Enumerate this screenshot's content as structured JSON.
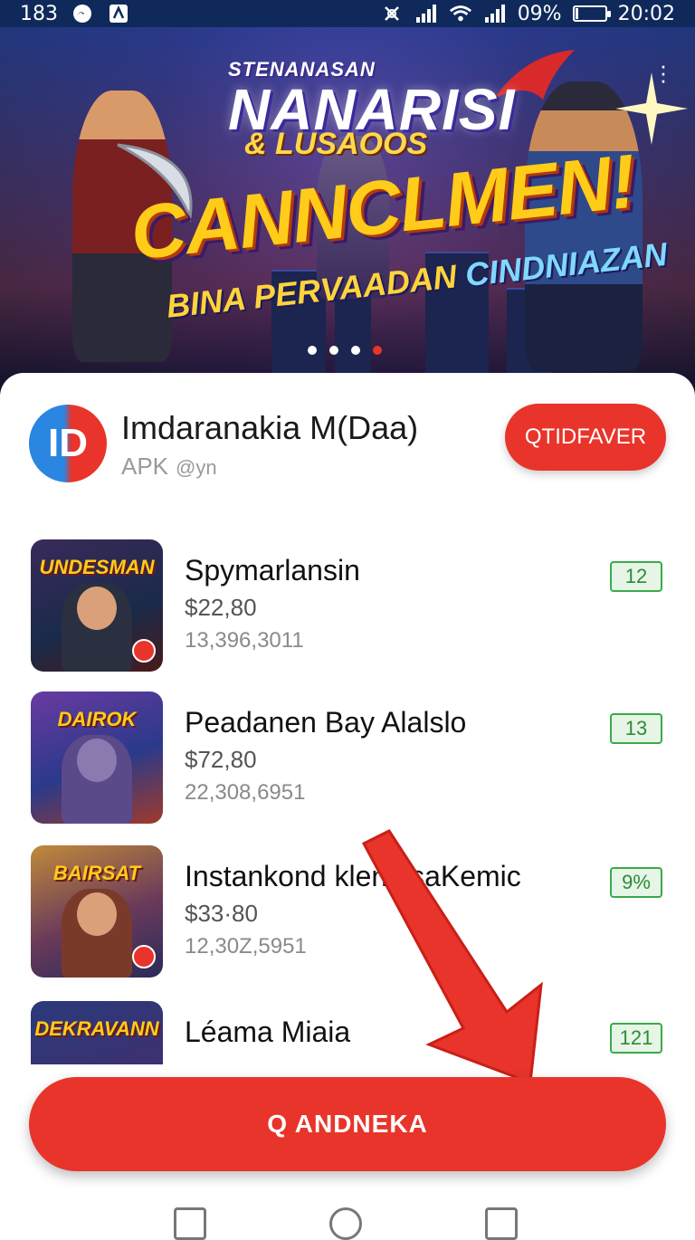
{
  "status_bar": {
    "left_text": "183",
    "battery_percent": "09%",
    "time": "20:02",
    "icons": [
      "messenger-icon",
      "notification-icon",
      "mute-icon",
      "signal-icon",
      "wifi-icon",
      "battery-icon"
    ],
    "battery_level": 0.09
  },
  "banner": {
    "line1": "STENANASAN",
    "line2": "NANARISI",
    "line3": "& LUSAOOS",
    "line4": "CANNCLMEN!",
    "line5_yellow": "BINA PERVAADAN",
    "line5_cyan": "CINDNIAZAN",
    "carousel_total": 4,
    "carousel_active": 4
  },
  "app": {
    "logo_text": "ID",
    "name": "Imdaranakia M(Daa)",
    "subtitle": "APK",
    "subtitle_handle": "@yn",
    "top_button": "QTIDFAVER"
  },
  "items": [
    {
      "title": "Spymarlansin",
      "price": "$22,80",
      "count": "13,396,3011",
      "badge": "12",
      "thumb_title": "UNDESMAN"
    },
    {
      "title": "Peadanen Bay Alalslo",
      "price": "$72,80",
      "count": "22,308,6951",
      "badge": "13",
      "thumb_title": "DAIROK"
    },
    {
      "title": "Instankond klenalsaKemic",
      "price": "$33·80",
      "count": "12,30Z,5951",
      "badge": "9%",
      "thumb_title": "BAIRSAT"
    },
    {
      "title": "Léama Miaia",
      "price": "",
      "count": "",
      "badge": "121",
      "thumb_title": "DEKRAVANN"
    }
  ],
  "cta_label": "Q ANDNEKA",
  "colors": {
    "accent": "#e8342a",
    "badge_green": "#3aaa4a",
    "statusbar": "#0f2a5a"
  }
}
